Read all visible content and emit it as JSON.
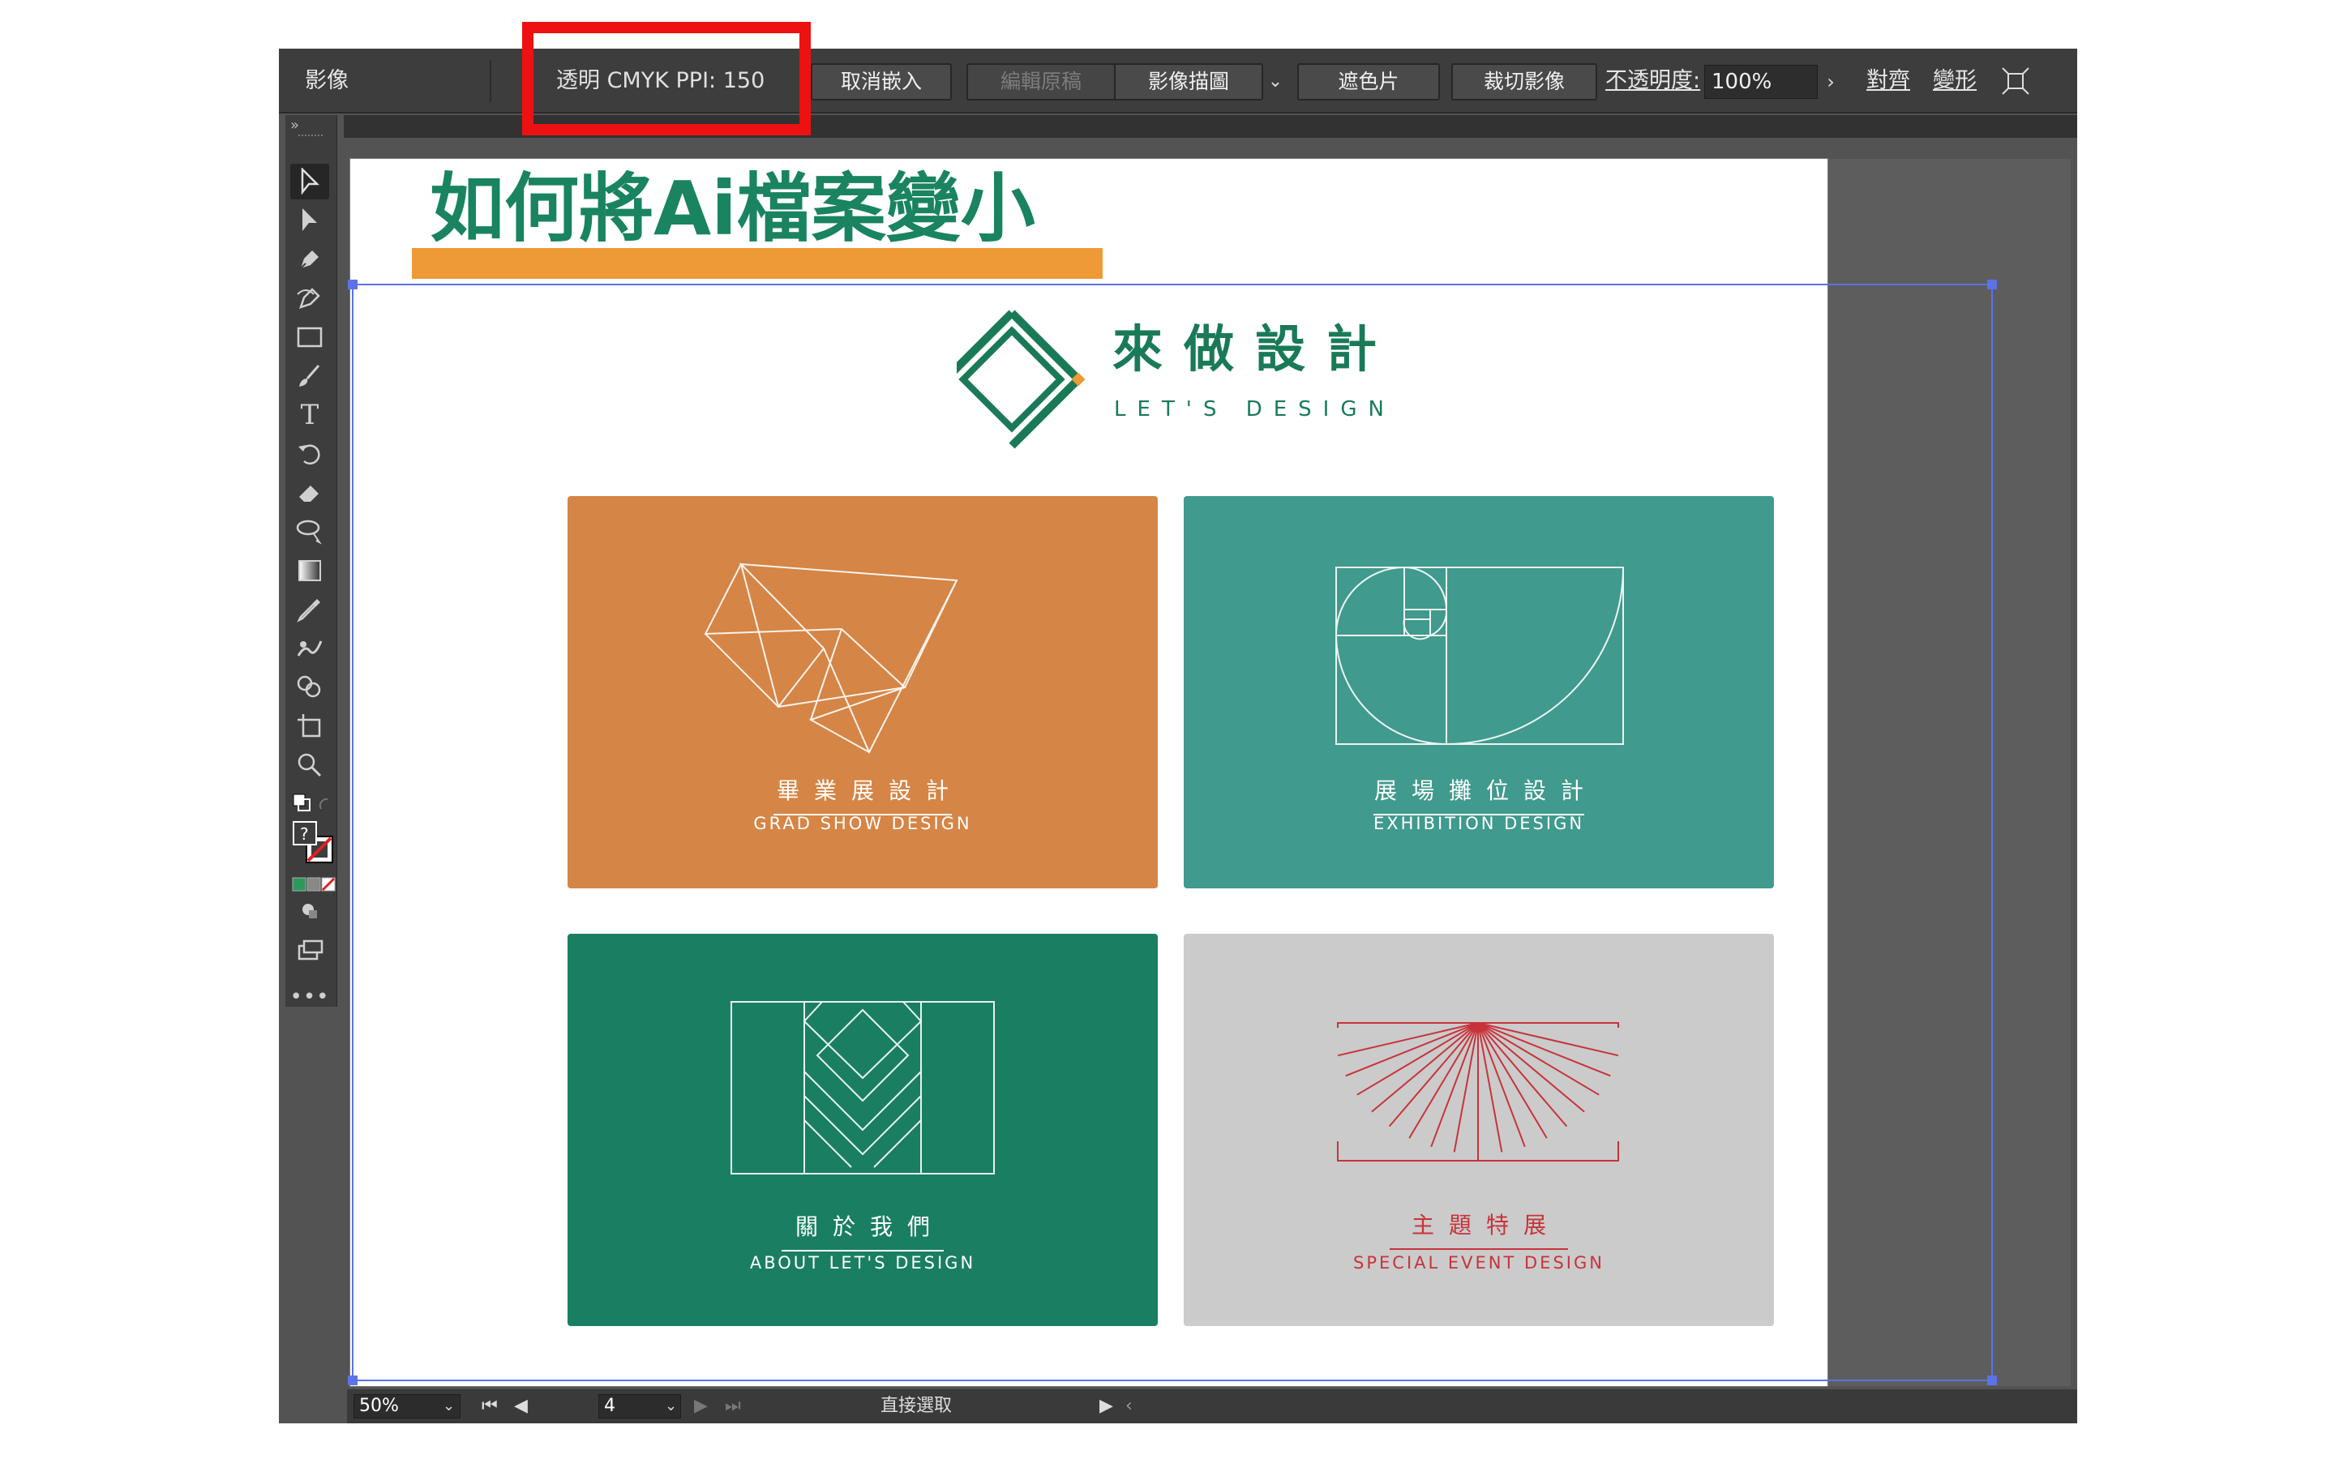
{
  "control_bar": {
    "panel_label": "影像",
    "info": "透明 CMYK  PPI: 150",
    "buttons": [
      "取消嵌入",
      "編輯原稿",
      "影像描圖",
      "遮色片",
      "裁切影像"
    ],
    "opacity_label": "不透明度:",
    "opacity_value": "100%",
    "align_label": "對齊",
    "transform_label": "變形"
  },
  "toolbar": {
    "tools": [
      "selection-tool-icon",
      "direct-selection-tool-icon",
      "pen-tool-icon",
      "curvature-tool-icon",
      "rectangle-tool-icon",
      "paintbrush-tool-icon",
      "type-tool-icon",
      "rotate-tool-icon",
      "eraser-tool-icon",
      "lasso-tool-icon",
      "gradient-tool-icon",
      "eyedropper-tool-icon",
      "puppet-warp-tool-icon",
      "shape-builder-tool-icon",
      "artboard-tool-icon",
      "zoom-tool-icon"
    ],
    "more": "•••"
  },
  "document": {
    "title": "如何將Ai檔案變小",
    "logo_cn": "來做設計",
    "logo_en": "LET'S  DESIGN",
    "cards": [
      {
        "cn": "畢業展設計",
        "en": "GRAD SHOW DESIGN",
        "bg": "#d58546",
        "fg": "#ffffff"
      },
      {
        "cn": "展場攤位設計",
        "en": "EXHIBITION DESIGN",
        "bg": "#409a8d",
        "fg": "#ffffff"
      },
      {
        "cn": "關於我們",
        "en": "ABOUT LET'S DESIGN",
        "bg": "#1a7f62",
        "fg": "#ffffff"
      },
      {
        "cn": "主題特展",
        "en": "SPECIAL EVENT DESIGN",
        "bg": "#cbcbcb",
        "fg": "#c8333a"
      }
    ]
  },
  "status_bar": {
    "zoom": "50%",
    "page": "4",
    "tool_name": "直接選取"
  },
  "colors": {
    "brand_green": "#19845f",
    "accent_orange": "#ee9a37",
    "highlight_red": "#ee1111",
    "selection_blue": "#5b72e8"
  }
}
